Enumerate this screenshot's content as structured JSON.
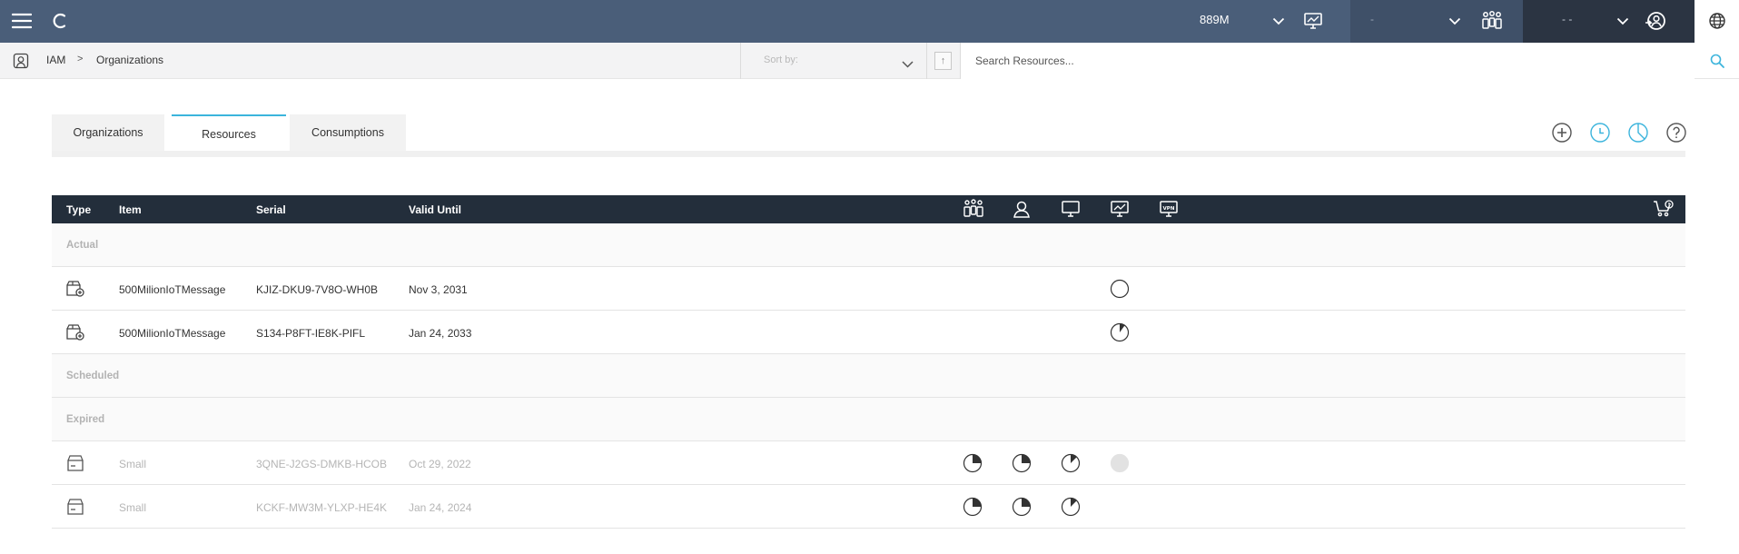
{
  "topbar": {
    "menu_icon": "hamburger-menu-icon",
    "logo_icon": "app-logo-icon",
    "usage_value": "889M",
    "org_selector_text": "-",
    "user_selector_text": "- -",
    "colors": {
      "primary": "#4a5e79",
      "secondary": "#3f5068",
      "dark": "#2b3442"
    }
  },
  "subbar": {
    "breadcrumb": [
      "IAM",
      "Organizations"
    ],
    "breadcrumb_separator": ">",
    "sort_placeholder": "Sort by:",
    "sort_direction_symbol": "↑",
    "search_placeholder": "Search Resources..."
  },
  "tabs": [
    {
      "label": "Organizations",
      "active": false
    },
    {
      "label": "Resources",
      "active": true
    },
    {
      "label": "Consumptions",
      "active": false
    }
  ],
  "actions": [
    "add-icon",
    "clock-icon",
    "pie-chart-icon",
    "help-icon"
  ],
  "accent_color": "#3bb4dc",
  "table": {
    "columns": [
      "Type",
      "Item",
      "Serial",
      "Valid Until"
    ],
    "header_icons": [
      "devices-icon",
      "user-icon",
      "desktop-icon",
      "monitor-chart-icon",
      "vpn-icon",
      "cart-icon"
    ],
    "groups": {
      "actual": "Actual",
      "scheduled": "Scheduled",
      "expired": "Expired"
    },
    "actual_rows": [
      {
        "item": "500MilionIoTMessage",
        "serial": "KJIZ-DKU9-7V8O-WH0B",
        "valid_until": "Nov 3, 2031"
      },
      {
        "item": "500MilionIoTMessage",
        "serial": "S134-P8FT-IE8K-PIFL",
        "valid_until": "Jan 24, 2033"
      }
    ],
    "expired_rows": [
      {
        "item": "Small",
        "serial": "3QNE-J2GS-DMKB-HCOB",
        "valid_until": "Oct 29, 2022"
      },
      {
        "item": "Small",
        "serial": "KCKF-MW3M-YLXP-HE4K",
        "valid_until": "Jan 24, 2024"
      }
    ]
  }
}
